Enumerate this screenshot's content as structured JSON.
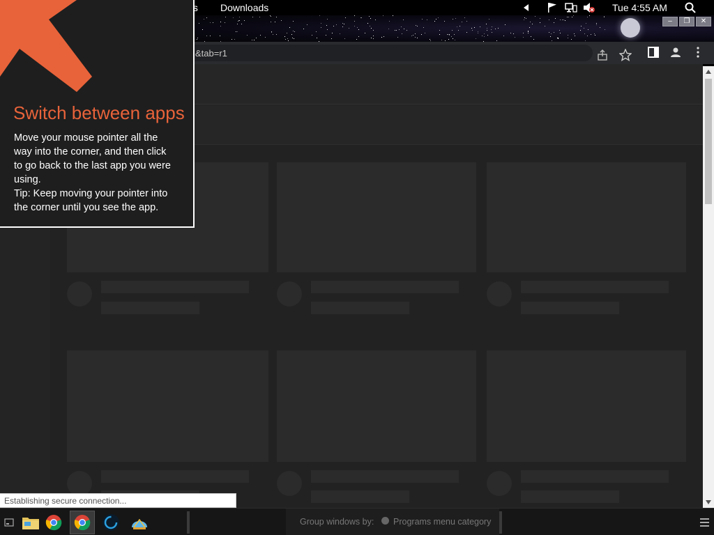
{
  "top_panel": {
    "menu_places_partial": "ts",
    "menu_downloads": "Downloads",
    "clock": "Tue 4:55 AM"
  },
  "window": {
    "minimize_label": "–",
    "restore_label": "❐",
    "close_label": "✕"
  },
  "browser": {
    "url_fragment": "&tab=r1"
  },
  "tooltip": {
    "title": "Switch between apps",
    "body_lines": [
      "Move your mouse pointer all the",
      "way into the corner, and then click",
      "to go back to the last app you were",
      "using.",
      "Tip: Keep moving your pointer into",
      "the corner until you see the app."
    ]
  },
  "status_bubble": "Establishing secure connection...",
  "taskbar": {
    "group_label": "Group windows by:",
    "group_option": "Programs menu category"
  },
  "colors": {
    "accent": "#e8633a",
    "page_bg": "#222222",
    "skeleton": "#2b2b2b"
  }
}
